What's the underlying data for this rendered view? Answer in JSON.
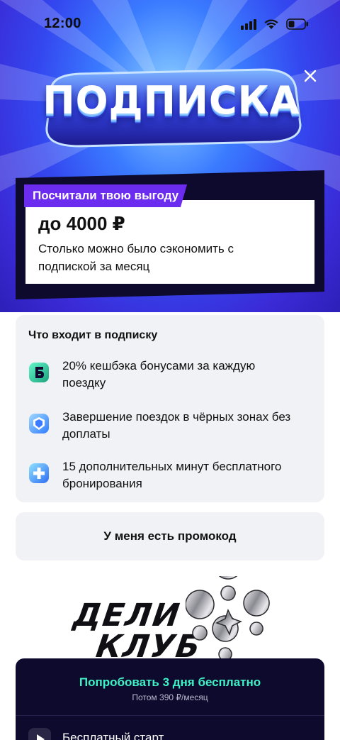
{
  "status_bar": {
    "time": "12:00"
  },
  "hero": {
    "logo_text": "ПОДПИСКА"
  },
  "savings": {
    "tag": "Посчитали твою выгоду",
    "amount": "до 4000 ₽",
    "description": "Столько можно было сэкономить с подпиской за месяц"
  },
  "features": {
    "title": "Что входит в подписку",
    "items": [
      {
        "icon": "bonus-b-icon",
        "text": "20% кешбэка бонусами за каждую поездку"
      },
      {
        "icon": "shield-icon",
        "text": "Завершение поездок в чёрных зонах без доплаты"
      },
      {
        "icon": "plus-icon",
        "text": "15 дополнительных минут бесплатного бронирования"
      }
    ]
  },
  "promo": {
    "label": "У меня есть промокод"
  },
  "club": {
    "line1": "ДЕЛИ",
    "line2": "КЛУБ"
  },
  "cta": {
    "title": "Попробовать 3 дня бесплатно",
    "subtitle": "Потом 390 ₽/месяц",
    "free_start": "Бесплатный старт"
  },
  "colors": {
    "accent_purple": "#6c2cf0",
    "dark_navy": "#0d0a2e",
    "cta_green": "#3ef3c5",
    "card_bg": "#f1f2f6"
  }
}
